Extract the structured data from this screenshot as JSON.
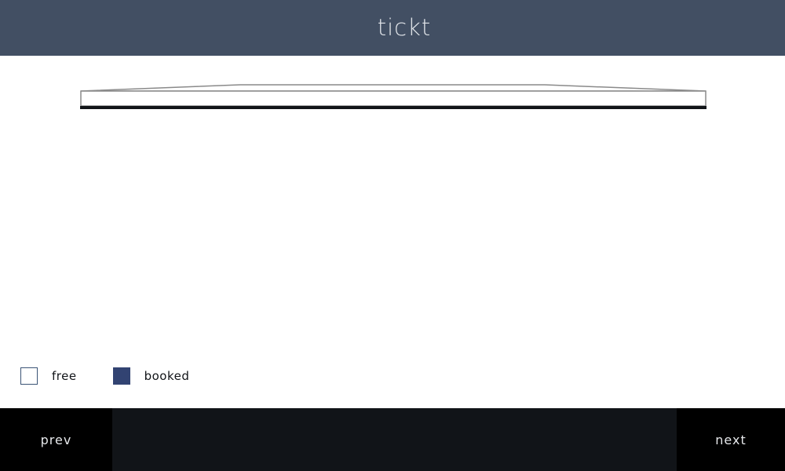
{
  "header": {
    "title": "tickt"
  },
  "legend": {
    "items": [
      {
        "label": "free",
        "status": "free"
      },
      {
        "label": "booked",
        "status": "booked"
      }
    ]
  },
  "footer": {
    "prev_label": "prev",
    "next_label": "next"
  },
  "colors": {
    "header_bg": "#424f63",
    "header_text": "#dfe3e8",
    "screen_stroke": "#8a8a8a",
    "screen_bar": "#111418",
    "free_border": "#3b5476",
    "booked_fill": "#324372",
    "footer_bg": "#111418",
    "nav_bg": "#000000",
    "nav_text": "#e6e8eb"
  }
}
